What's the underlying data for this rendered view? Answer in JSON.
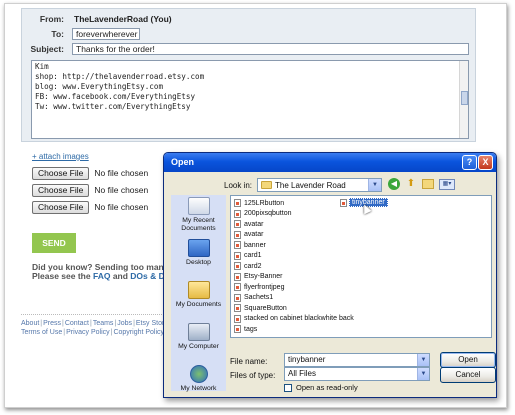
{
  "compose": {
    "from_label": "From:",
    "from_value": "TheLavenderRoad (You)",
    "to_label": "To:",
    "to_value": "foreverwherever",
    "subject_label": "Subject:",
    "subject_value": "Thanks for the order!",
    "message_lines": [
      "Kim",
      "",
      "shop: http://thelavenderroad.etsy.com",
      "blog: www.EverythingEtsy.com",
      "FB: www.facebook.com/EverythingEtsy",
      "Tw: www.twitter.com/EverythingEtsy"
    ]
  },
  "attach": {
    "link": "+ attach images",
    "choose_label": "Choose File",
    "no_file": "No file chosen"
  },
  "send_label": "SEND",
  "did_you_know": {
    "line1": "Did you know? Sending too many mess",
    "line2_prefix": "Please see the ",
    "faq": "FAQ",
    "and": " and ",
    "dos": "DOs & DON'Ts"
  },
  "footer": {
    "row1": [
      "About",
      "Press",
      "Contact",
      "Teams",
      "Jobs",
      "Etsy Store"
    ],
    "row2": [
      "Terms of Use",
      "Privacy Policy",
      "Copyright Policy"
    ]
  },
  "dialog": {
    "title": "Open",
    "help": "?",
    "close": "X",
    "look_in_label": "Look in:",
    "look_in_value": "The Lavender Road",
    "places": [
      "My Recent Documents",
      "Desktop",
      "My Documents",
      "My Computer",
      "My Network"
    ],
    "files": [
      "125LRbutton",
      "200pixsqbutton",
      "avatar",
      "avatar",
      "banner",
      "card1",
      "card2",
      "Etsy-Banner",
      "flyerfrontjpeg",
      "Sachets1",
      "SquareButton",
      "stacked on cabinet blackwhite back",
      "tags"
    ],
    "selected_file": "tinybanner",
    "file_name_label": "File name:",
    "file_name_value": "tinybanner",
    "files_of_type_label": "Files of type:",
    "files_of_type_value": "All Files",
    "open_label": "Open",
    "cancel_label": "Cancel",
    "readonly_label": "Open as read-only"
  },
  "colors": {
    "title_bar": "#0a54dd",
    "send_green": "#93c64f",
    "link_blue": "#2d6aa6",
    "selection": "#316ac5"
  }
}
